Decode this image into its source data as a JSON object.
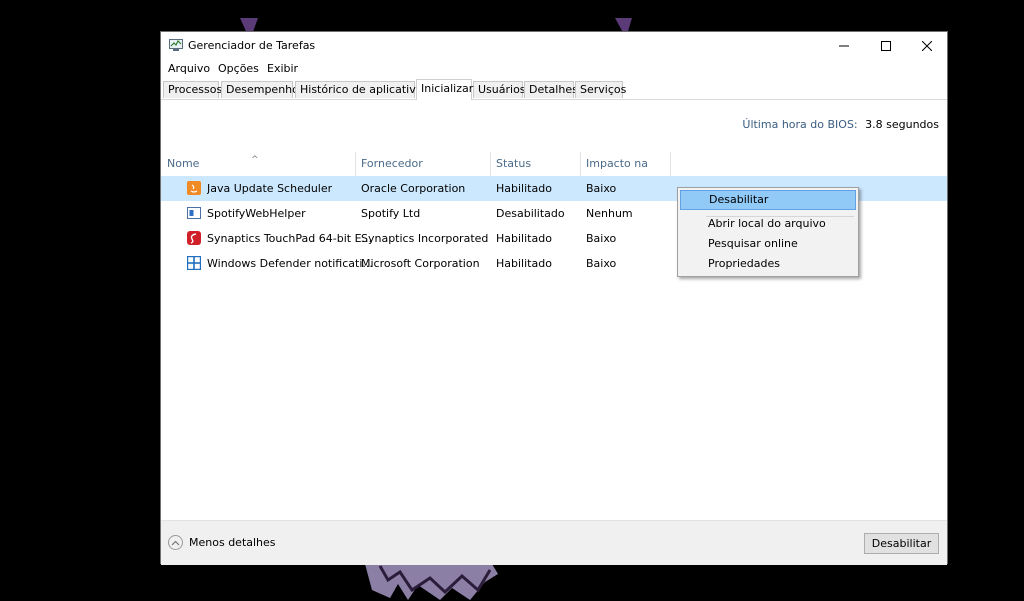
{
  "window": {
    "title": "Gerenciador de Tarefas",
    "controls": {
      "minimize": "minimize-icon",
      "maximize": "maximize-icon",
      "close": "close-icon"
    }
  },
  "menu": [
    "Arquivo",
    "Opções",
    "Exibir"
  ],
  "tabs": [
    "Processos",
    "Desempenho",
    "Histórico de aplicativos",
    "Inicializar",
    "Usuários",
    "Detalhes",
    "Serviços"
  ],
  "active_tab": "Inicializar",
  "bios": {
    "label": "Última hora do BIOS:",
    "value": "3.8 segundos"
  },
  "columns": [
    "Nome",
    "Fornecedor",
    "Status",
    "Impacto na ini..."
  ],
  "rows": [
    {
      "icon": "java-icon",
      "name": "Java Update Scheduler",
      "publisher": "Oracle Corporation",
      "status": "Habilitado",
      "impact": "Baixo",
      "selected": true
    },
    {
      "icon": "spotify-helper-icon",
      "name": "SpotifyWebHelper",
      "publisher": "Spotify Ltd",
      "status": "Desabilitado",
      "impact": "Nenhum",
      "selected": false
    },
    {
      "icon": "synaptics-icon",
      "name": "Synaptics TouchPad 64-bit E...",
      "publisher": "Synaptics Incorporated",
      "status": "Habilitado",
      "impact": "Baixo",
      "selected": false
    },
    {
      "icon": "windows-defender-icon",
      "name": "Windows Defender notificati...",
      "publisher": "Microsoft Corporation",
      "status": "Habilitado",
      "impact": "Baixo",
      "selected": false
    }
  ],
  "context_menu": [
    "Desabilitar",
    "Abrir local do arquivo",
    "Pesquisar online",
    "Propriedades"
  ],
  "footer": {
    "less_details": "Menos detalhes",
    "disable_button": "Desabilitar"
  },
  "colors": {
    "selection": "#cce8ff",
    "menu_highlight": "#91c9f7",
    "header_text": "#4a6b8a"
  }
}
